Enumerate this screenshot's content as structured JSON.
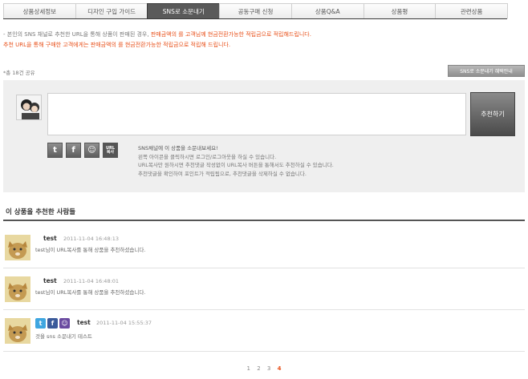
{
  "tabs": [
    {
      "label": "상품상세정보",
      "active": false
    },
    {
      "label": "디자인 구입 가이드",
      "active": false
    },
    {
      "label": "SNS로 소문내기",
      "active": true
    },
    {
      "label": "공동구매 신청",
      "active": false
    },
    {
      "label": "상품Q&A",
      "active": false
    },
    {
      "label": "상품평",
      "active": false
    },
    {
      "label": "관련상품",
      "active": false
    }
  ],
  "notice": {
    "line1_prefix": "- 본인의 SNS 채널로 추천한 URL을 통해 상품이 판매된 경우, ",
    "line1_highlight": "판매금액의 를 고객님께 현금전환가능한 적립금으로 적립해드립니다.",
    "line2": "추천 URL을 통해 구매한 고객에게는 판매금액의 를 현금전환가능한 적립금으로 적립해 드립니다."
  },
  "share_count": "*총 18건 공유",
  "guide_button": "SNS로 소문내기 혜택안내",
  "comment_placeholder": "",
  "recommend_button": "추천하기",
  "sns_icons": [
    {
      "name": "twitter-icon",
      "glyph": "t"
    },
    {
      "name": "facebook-icon",
      "glyph": "f"
    },
    {
      "name": "me2day-icon",
      "glyph": "☺"
    },
    {
      "name": "url-copy-icon",
      "glyph": "URL 복사"
    }
  ],
  "help": [
    "SNS채널에 이 상품을 소문내보세요!",
    "왼쪽 아이콘을 클릭하시면 로그인/로그아웃을 하실 수 있습니다.",
    "URL복사만 원하시면 추천댓글 작성없이 URL복사 버튼을 통해서도 추천하실 수 있습니다.",
    "추천댓글을 확인하여 포인트가 적립됨으로, 추천댓글을 삭제하실 수 없습니다."
  ],
  "section_title": "이 상품을 추천한 사람들",
  "entries": [
    {
      "name": "test",
      "time": "2011-11-04 16:48:13",
      "message": "test님이 URL복사를 통해 상품을 추천하셨습니다."
    },
    {
      "name": "test",
      "time": "2011-11-04 16:48:01",
      "message": "test님이 URL복사를 통해 상품을 추천하셨습니다."
    },
    {
      "name": "test",
      "time": "2011-11-04 15:55:37",
      "message": "것을 sns 소문내기 테스트",
      "icons": [
        "twitter-icon",
        "facebook-icon",
        "me2day-icon"
      ]
    }
  ],
  "pagination": {
    "pages": [
      "1",
      "2",
      "3",
      "4"
    ],
    "current": "4"
  },
  "colors": {
    "accent": "#e8501a",
    "tab_active": "#5a5a5a",
    "panel": "#efefef"
  }
}
